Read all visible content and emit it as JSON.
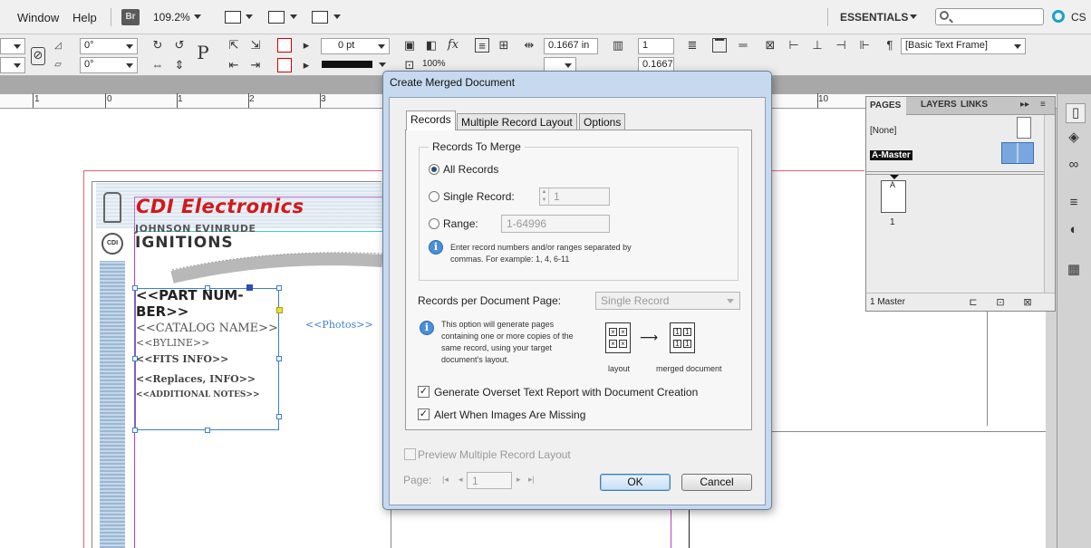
{
  "menubar": {
    "items": [
      "Window",
      "Help"
    ],
    "bridge_icon_label": "Br",
    "zoom": "109.2%",
    "workspace": "ESSENTIALS",
    "cs_label": "CS"
  },
  "control_panel": {
    "rotate_angle": "0°",
    "shear_angle": "0°",
    "stroke_weight": "0 pt",
    "opacity": "100%",
    "width_value": "0.1667 in",
    "height_value": "0.1667 i",
    "columns": "1",
    "object_style": "[Basic Text Frame]"
  },
  "ruler": {
    "labels": [
      "1",
      "0",
      "1",
      "2",
      "3",
      "10"
    ]
  },
  "document": {
    "logo": "CDI Electronics",
    "brand_line": "JOHNSON EVINRUDE",
    "product_line": "IGNITIONS",
    "photos_placeholder": "<<Photos>>",
    "frame_lines": [
      "<<PART NUM-",
      "BER>>",
      "<<CATALOG NAME>>",
      "<<BYLINE>>",
      "<<FITS INFO>>",
      "<<Replaces, INFO>>",
      "<<ADDITIONAL NOTES>>"
    ]
  },
  "pages_panel": {
    "tabs": [
      "PAGES",
      "LAYERS",
      "LINKS"
    ],
    "none_label": "[None]",
    "master_label": "A-Master",
    "page_prefix": "A",
    "page_number": "1",
    "footer": "1 Master"
  },
  "dialog": {
    "title": "Create Merged Document",
    "tabs": [
      "Records",
      "Multiple Record Layout",
      "Options"
    ],
    "records_group_title": "Records To Merge",
    "all_records": "All Records",
    "single_record": "Single Record:",
    "single_record_value": "1",
    "range": "Range:",
    "range_value": "1-64996",
    "range_hint_line1": "Enter record numbers and/or ranges separated by",
    "range_hint_line2": "commas. For example: 1, 4, 6-11",
    "per_page_label": "Records per Document Page:",
    "per_page_value": "Single Record",
    "option_hint": [
      "This option will generate pages",
      "containing one or more copies of the",
      "same record, using your target",
      "document's layout."
    ],
    "diagram_left": "layout",
    "diagram_right": "merged document",
    "overset_check": "Generate Overset Text Report with Document Creation",
    "alert_check": "Alert When Images Are Missing",
    "preview_check": "Preview Multiple Record Layout",
    "page_label": "Page:",
    "page_value": "1",
    "ok": "OK",
    "cancel": "Cancel"
  }
}
